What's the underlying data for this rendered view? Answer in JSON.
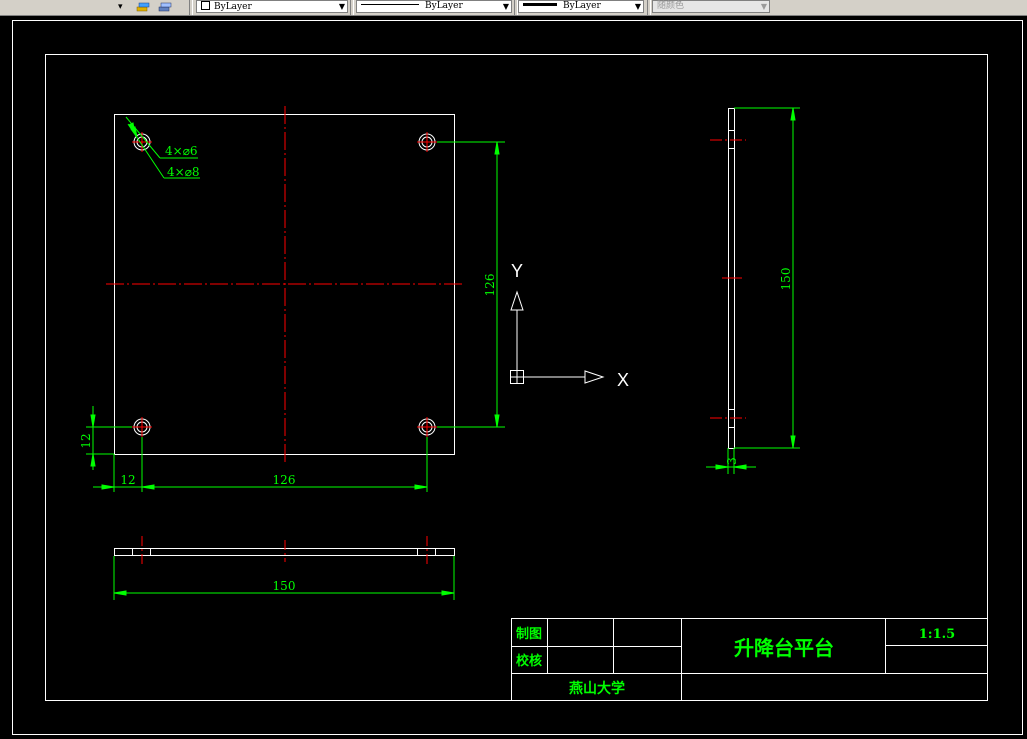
{
  "toolbar": {
    "color_combo": "ByLayer",
    "linetype_combo": "ByLayer",
    "lineweight_combo": "ByLayer",
    "plotstyle_combo": "随颜色"
  },
  "drawing": {
    "top_view": {
      "hole_label_1": "4×⌀6",
      "hole_label_2": "4×⌀8",
      "dim_vertical": "126",
      "dim_bottom_offset": "12",
      "dim_left_offset": "12",
      "dim_horizontal": "126"
    },
    "front_view": {
      "dim_width": "150"
    },
    "side_view": {
      "dim_height": "150",
      "dim_thickness": "3"
    },
    "ucs": {
      "y_label": "Y",
      "x_label": "X"
    },
    "title_block": {
      "drawn_by": "制图",
      "checked_by": "校核",
      "title": "升降台平台",
      "scale": "1:1.5",
      "school": "燕山大学"
    }
  },
  "colors": {
    "background": "#000000",
    "outline": "#ffffff",
    "dimension": "#00ff00",
    "centerline": "#ff0000"
  }
}
